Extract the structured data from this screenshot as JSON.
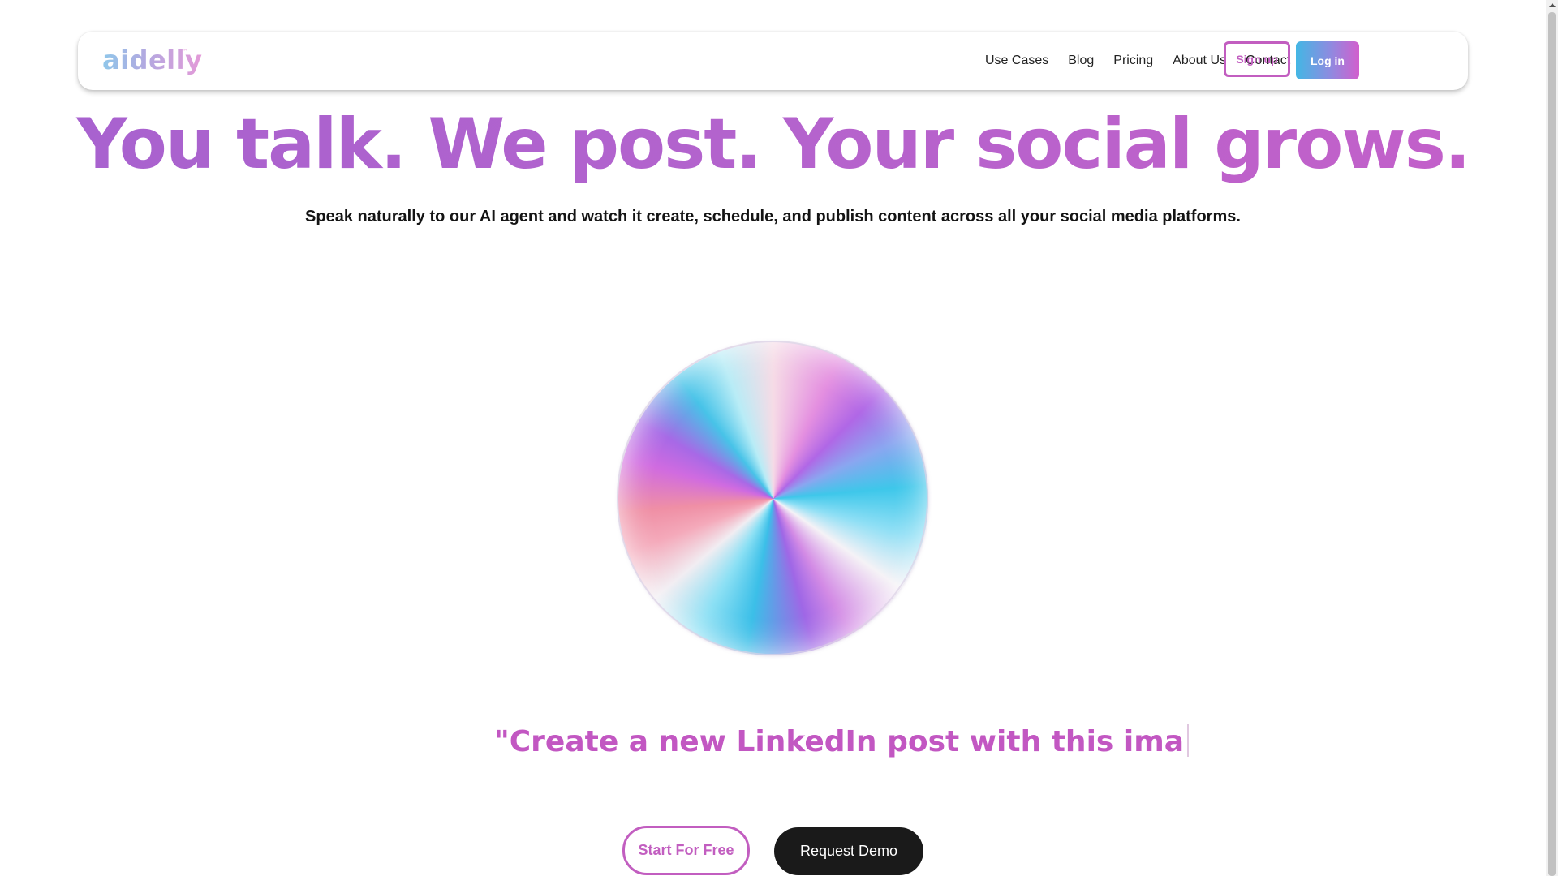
{
  "brand": {
    "logo_text": "aidelly",
    "logo_mark": "™",
    "accent_purple": "#b463cd",
    "accent_pink": "#c25ec0",
    "accent_blue": "#43b7e4"
  },
  "nav": {
    "links": [
      "Use Cases",
      "Blog",
      "Pricing",
      "About Us",
      "Contact"
    ],
    "signup_label": "Sign up",
    "login_label": "Log in"
  },
  "hero": {
    "title": "You talk. We post. Your social grows.",
    "subtitle": "Speak naturally to our AI agent and watch it create, schedule, and publish content across all your social media platforms."
  },
  "orb": {
    "icon": "gradient-orb-visual"
  },
  "prompt": {
    "typed_text": "\"Create a new LinkedIn post with this ima"
  },
  "cta": {
    "start_label": "Start For Free",
    "demo_label": "Request Demo"
  }
}
